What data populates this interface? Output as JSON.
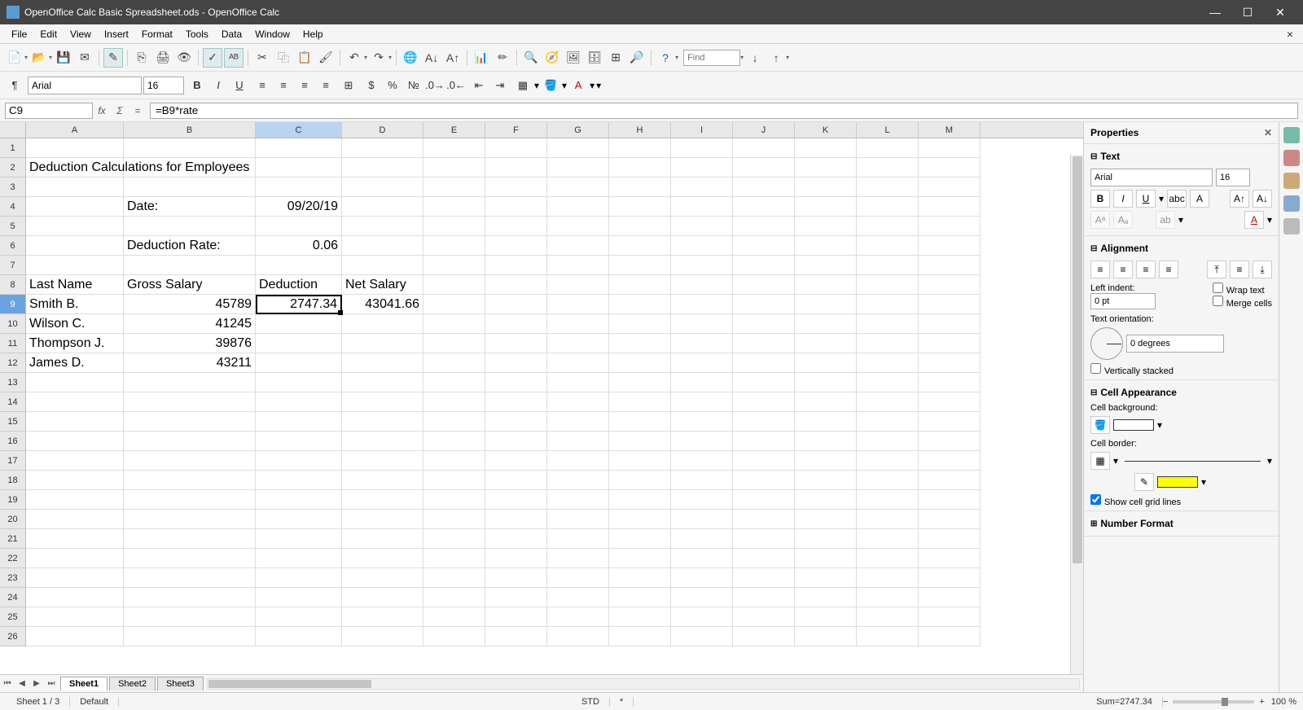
{
  "title": "OpenOffice Calc Basic Spreadsheet.ods - OpenOffice Calc",
  "menu": [
    "File",
    "Edit",
    "View",
    "Insert",
    "Format",
    "Tools",
    "Data",
    "Window",
    "Help"
  ],
  "toolbar_find_placeholder": "Find",
  "font_name": "Arial",
  "font_size": "16",
  "cell_ref": "C9",
  "formula": "=B9*rate",
  "columns": [
    "A",
    "B",
    "C",
    "D",
    "E",
    "F",
    "G",
    "H",
    "I",
    "J",
    "K",
    "L",
    "M"
  ],
  "selected_col": "C",
  "selected_row": 9,
  "cells": {
    "A2": "Deduction Calculations for Employees",
    "B4": "Date:",
    "C4": "09/20/19",
    "B6": "Deduction Rate:",
    "C6": "0.06",
    "A8": "Last Name",
    "B8": "Gross Salary",
    "C8": "Deduction",
    "D8": "Net Salary",
    "A9": "Smith B.",
    "B9": "45789",
    "C9": "2747.34",
    "D9": "43041.66",
    "A10": "Wilson C.",
    "B10": "41245",
    "A11": "Thompson J.",
    "B11": "39876",
    "A12": "James D.",
    "B12": "43211"
  },
  "tabs": [
    "Sheet1",
    "Sheet2",
    "Sheet3"
  ],
  "active_tab": "Sheet1",
  "status": {
    "sheet": "Sheet 1 / 3",
    "style": "Default",
    "mode": "STD",
    "mod": "*",
    "sum": "Sum=2747.34",
    "zoom": "100 %"
  },
  "sidebar": {
    "title": "Properties",
    "text": {
      "title": "Text",
      "font": "Arial",
      "size": "16"
    },
    "alignment": {
      "title": "Alignment",
      "left_indent_label": "Left indent:",
      "left_indent": "0 pt",
      "wrap": "Wrap text",
      "merge": "Merge cells",
      "orient_label": "Text orientation:",
      "orient": "0 degrees",
      "vstack": "Vertically stacked"
    },
    "appearance": {
      "title": "Cell Appearance",
      "bg_label": "Cell background:",
      "border_label": "Cell border:",
      "grid": "Show cell grid lines"
    },
    "numfmt": {
      "title": "Number Format"
    }
  }
}
